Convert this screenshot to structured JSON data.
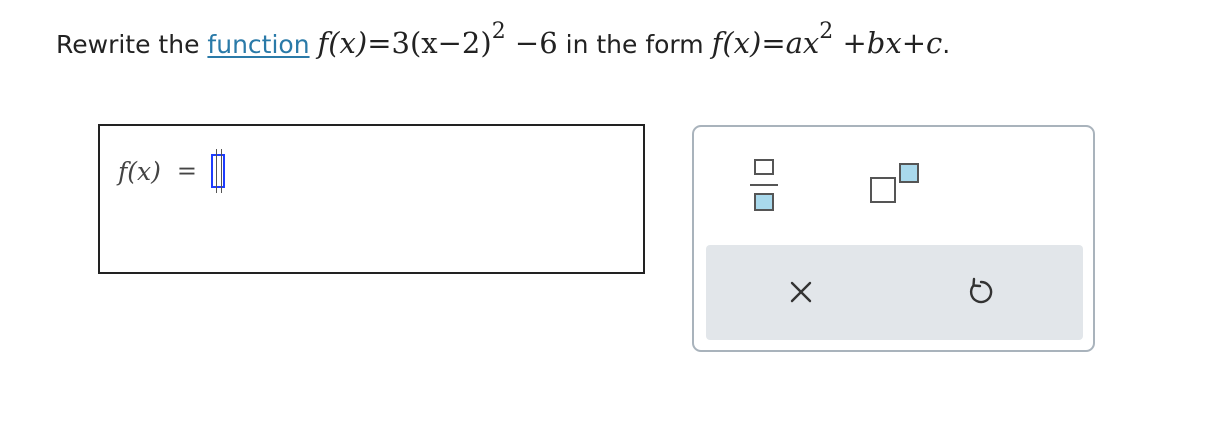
{
  "question": {
    "prefix": "Rewrite the",
    "link_text": "function",
    "given_lhs": "f(x)",
    "given_rhs_main": "=3(x−2)",
    "given_exponent": "2",
    "given_rhs_tail": "−6",
    "middle": "in the form",
    "target_lhs": "f(x)",
    "target_rhs_head": "=ax",
    "target_exponent": "2",
    "target_rhs_tail": "+bx+c",
    "suffix": "."
  },
  "answer": {
    "lhs": "f(x)",
    "equals": "=",
    "value": ""
  },
  "palette": {
    "tools": [
      "fraction-template",
      "exponent-template"
    ],
    "actions": [
      "clear",
      "undo"
    ],
    "accent_color": "#a9d9ec",
    "slot_border_color": "#1e3cff",
    "link_color": "#2a7aa8"
  }
}
